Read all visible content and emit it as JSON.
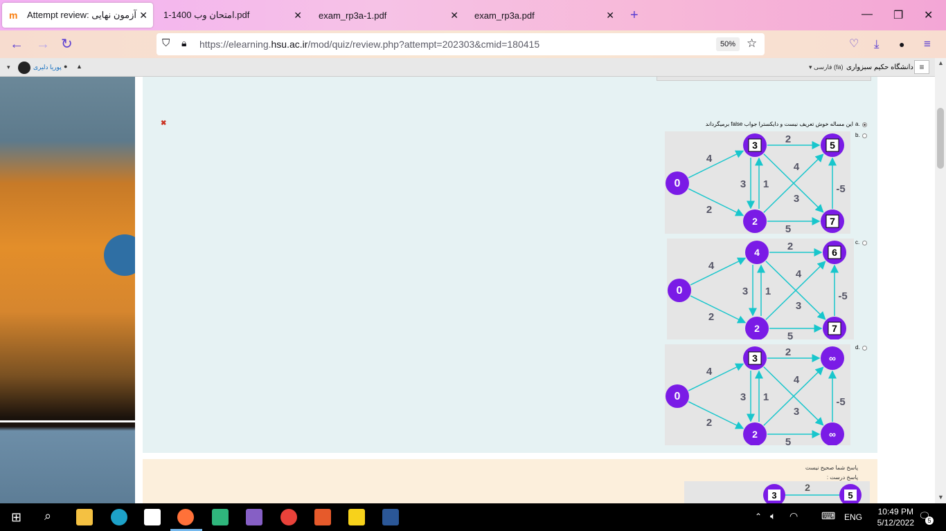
{
  "browser": {
    "tabs": [
      {
        "title": "Attempt review: آزمون نهایی",
        "active": true
      },
      {
        "title": "امتحان وب 1400-1.pdf",
        "active": false
      },
      {
        "title": "exam_rp3a-1.pdf",
        "active": false
      },
      {
        "title": "exam_rp3a.pdf",
        "active": false
      }
    ],
    "url_prefix": "https://elearning.",
    "url_domain": "hsu.ac.ir",
    "url_rest": "/mod/quiz/review.php?attempt=202303&cmid=180415",
    "zoom": "50%"
  },
  "moodle_nav": {
    "site_name": "دانشگاه حکیم سبزواری",
    "language": "فارسی (fa)",
    "user_name": "پوریا دلیری"
  },
  "question": {
    "option_a_label": "a.",
    "option_a_text": "این مساله خوش تعریف نیست و دایکسترا جواب false برمیگرداند",
    "option_b_label": "b.",
    "option_c_label": "c.",
    "option_d_label": "d.",
    "graphs": [
      {
        "nodes": {
          "src": "0",
          "top": "3",
          "bottom": "2",
          "tr": "5",
          "br": "7"
        },
        "top_boxed": true,
        "tr_boxed": true,
        "br_boxed": true
      },
      {
        "nodes": {
          "src": "0",
          "top": "4",
          "bottom": "2",
          "tr": "6",
          "br": "7"
        },
        "top_boxed": false,
        "tr_boxed": true,
        "br_boxed": true
      },
      {
        "nodes": {
          "src": "0",
          "top": "3",
          "bottom": "2",
          "tr": "∞",
          "br": "∞"
        },
        "top_boxed": true,
        "tr_boxed": false,
        "br_boxed": false
      }
    ],
    "edges": {
      "src_top": "4",
      "src_bottom": "2",
      "top_tr": "2",
      "bottom_br": "5",
      "down": "3",
      "up": "1",
      "cross1": "4",
      "cross2": "3",
      "br_tr": "-5"
    }
  },
  "feedback": {
    "incorrect": "پاسخ شما صحیح نیست",
    "correct_answer": "پاسخ درست :",
    "preview_nodes": {
      "top": "3",
      "tr": "5"
    },
    "preview_edge": "2"
  },
  "taskbar": {
    "time": "10:49 PM",
    "date": "5/12/2022",
    "lang": "ENG",
    "notif_count": "5"
  }
}
